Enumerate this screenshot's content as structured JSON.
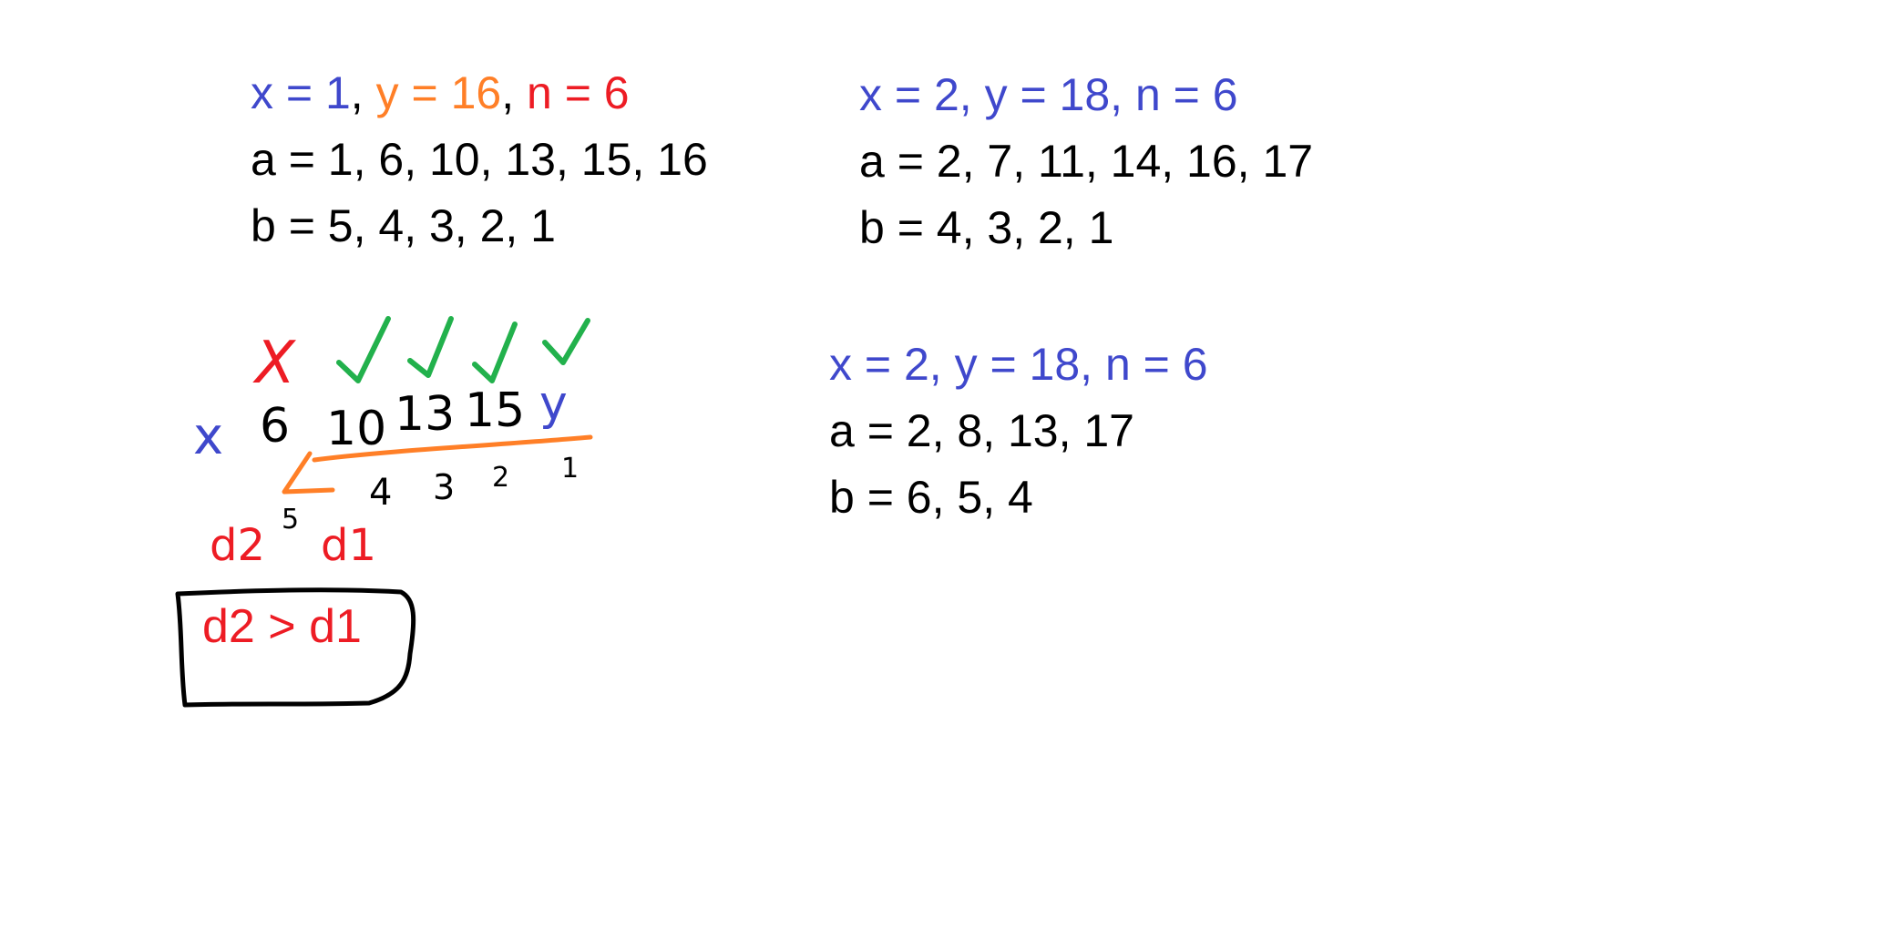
{
  "example_1": {
    "x_part": "x = 1",
    "sep1": ", ",
    "y_part": "y = 16",
    "sep2": ", ",
    "n_part": "n = 6",
    "a_line": "a = 1, 6, 10, 13, 15, 16",
    "b_line": "b = 5, 4, 3, 2, 1"
  },
  "example_2": {
    "header": "x = 2, y = 18, n = 6",
    "a_line": "a = 2, 7, 11, 14, 16, 17",
    "b_line": "b = 4, 3, 2, 1"
  },
  "example_3": {
    "header": "x = 2, y = 18, n = 6",
    "a_line": "a = 2, 8, 13, 17",
    "b_line": "b = 6, 5, 4"
  },
  "sketch": {
    "cross_mark": "X",
    "sequence_start": "x",
    "sequence_values": [
      "6",
      "10",
      "13",
      "15"
    ],
    "sequence_end": "y",
    "gap_values": [
      "5",
      "4",
      "3",
      "2",
      "1"
    ],
    "label_d2": "d2",
    "label_d1": "d1",
    "conclusion": "d2 > d1"
  },
  "colors": {
    "blue": "#3f48cc",
    "orange": "#ff7f27",
    "red": "#ed1c24",
    "green": "#22b14c",
    "black": "#000000"
  }
}
